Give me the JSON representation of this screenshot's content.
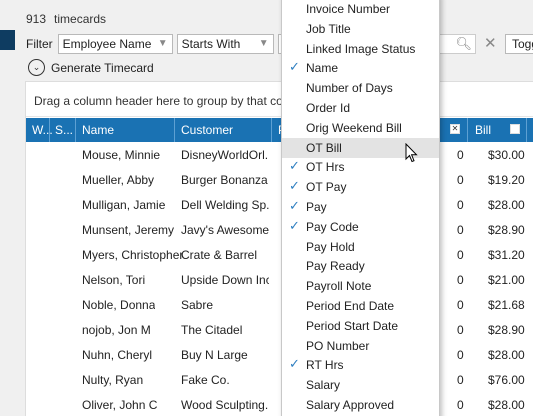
{
  "header": {
    "count": "913",
    "count_label": "timecards"
  },
  "filter": {
    "label": "Filter",
    "field": "Employee Name",
    "operator": "Starts With",
    "toggle_label": "Togg"
  },
  "generate": {
    "label": "Generate Timecard"
  },
  "grid": {
    "group_hint": "Drag a column header here to group by that co",
    "columns": [
      {
        "label": "W..."
      },
      {
        "label": "S..."
      },
      {
        "label": "Name"
      },
      {
        "label": "Customer"
      },
      {
        "label": "P"
      },
      {
        "label": "Bill"
      }
    ],
    "rows": [
      {
        "name": "Mouse, Minnie",
        "customer": "DisneyWorldOrl...",
        "ot": "0",
        "bill": "$30.00"
      },
      {
        "name": "Mueller, Abby",
        "customer": "Burger Bonanza",
        "ot": "0",
        "bill": "$19.20"
      },
      {
        "name": "Mulligan, Jamie",
        "customer": "Dell Welding Sp...",
        "ot": "0",
        "bill": "$28.00"
      },
      {
        "name": "Munsent, Jeremy",
        "customer": "Javy's Awesome...",
        "ot": "0",
        "bill": "$28.90"
      },
      {
        "name": "Myers, Christopher",
        "customer": "Crate & Barrel",
        "ot": "0",
        "bill": "$31.20"
      },
      {
        "name": "Nelson, Tori",
        "customer": "Upside Down Inc",
        "ot": "0",
        "bill": "$21.00"
      },
      {
        "name": "Noble, Donna",
        "customer": "Sabre",
        "ot": "0",
        "bill": "$21.68"
      },
      {
        "name": "nojob, Jon M",
        "customer": "The Citadel",
        "ot": "0",
        "bill": "$28.90"
      },
      {
        "name": "Nuhn, Cheryl",
        "customer": "Buy N Large",
        "ot": "0",
        "bill": "$28.00"
      },
      {
        "name": "Nulty, Ryan",
        "customer": "Fake Co.",
        "ot": "0",
        "bill": "$76.00"
      },
      {
        "name": "Oliver, John C",
        "customer": "Wood Sculpting...",
        "ot": "0",
        "bill": "$28.00"
      }
    ]
  },
  "column_menu": {
    "items": [
      {
        "label": "Invoice Number",
        "checked": false
      },
      {
        "label": "Job Title",
        "checked": false
      },
      {
        "label": "Linked Image Status",
        "checked": false
      },
      {
        "label": "Name",
        "checked": true
      },
      {
        "label": "Number of Days",
        "checked": false
      },
      {
        "label": "Order Id",
        "checked": false
      },
      {
        "label": "Orig Weekend Bill",
        "checked": false
      },
      {
        "label": "OT Bill",
        "checked": false,
        "highlighted": true
      },
      {
        "label": "OT Hrs",
        "checked": true
      },
      {
        "label": "OT Pay",
        "checked": true
      },
      {
        "label": "Pay",
        "checked": true
      },
      {
        "label": "Pay Code",
        "checked": true
      },
      {
        "label": "Pay Hold",
        "checked": false
      },
      {
        "label": "Pay Ready",
        "checked": false
      },
      {
        "label": "Payroll Note",
        "checked": false
      },
      {
        "label": "Period End Date",
        "checked": false
      },
      {
        "label": "Period Start Date",
        "checked": false
      },
      {
        "label": "PO Number",
        "checked": false
      },
      {
        "label": "RT Hrs",
        "checked": true
      },
      {
        "label": "Salary",
        "checked": false
      },
      {
        "label": "Salary Approved",
        "checked": false
      }
    ]
  },
  "colors": {
    "header_blue": "#1a72b3",
    "accent_navy": "#0e3c61",
    "check_blue": "#2f7fc1",
    "highlight": "#e3e3e3"
  }
}
